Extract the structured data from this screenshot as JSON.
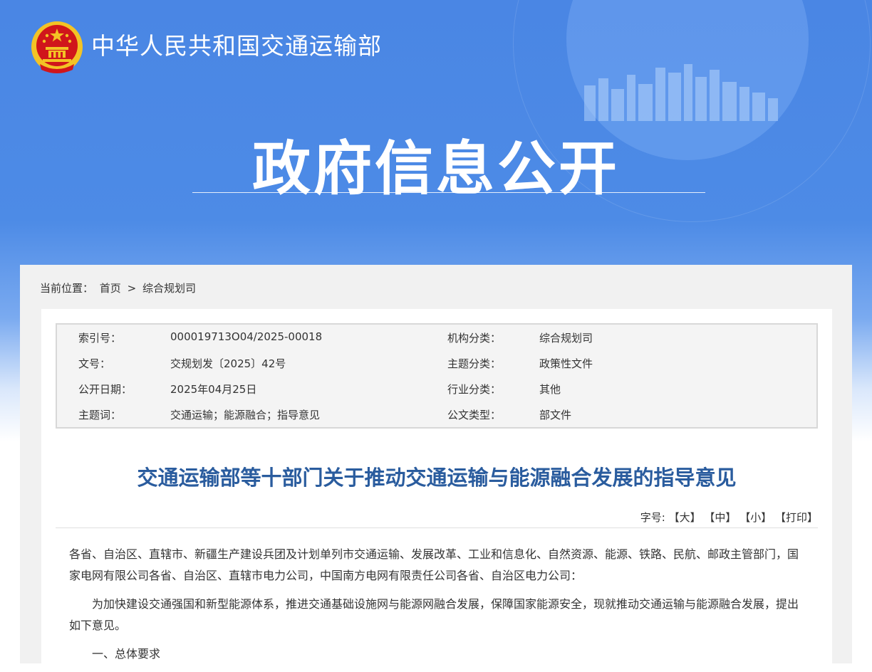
{
  "site": {
    "name": "中华人民共和国交通运输部",
    "banner_title": "政府信息公开"
  },
  "breadcrumb": {
    "prefix": "当前位置：",
    "items": [
      "首页",
      "综合规划司"
    ],
    "separator": ">"
  },
  "meta": {
    "rows": [
      {
        "label1": "索引号：",
        "value1": "000019713O04/2025-00018",
        "label2": "机构分类：",
        "value2": "综合规划司"
      },
      {
        "label1": "文号：",
        "value1": "交规划发〔2025〕42号",
        "label2": "主题分类：",
        "value2": "政策性文件"
      },
      {
        "label1": "公开日期：",
        "value1": "2025年04月25日",
        "label2": "行业分类：",
        "value2": "其他"
      },
      {
        "label1": "主题词：",
        "value1": "交通运输；能源融合；指导意见",
        "label2": "公文类型：",
        "value2": "部文件"
      }
    ]
  },
  "document": {
    "title": "交通运输部等十部门关于推动交通运输与能源融合发展的指导意见",
    "font_size_label": "字号:",
    "font_large": "【大】",
    "font_medium": "【中】",
    "font_small": "【小】",
    "print": "【打印】",
    "paragraphs": [
      "各省、自治区、直辖市、新疆生产建设兵团及计划单列市交通运输、发展改革、工业和信息化、自然资源、能源、铁路、民航、邮政主管部门，国家电网有限公司各省、自治区、直辖市电力公司，中国南方电网有限责任公司各省、自治区电力公司：",
      "为加快建设交通强国和新型能源体系，推进交通基础设施网与能源网融合发展，保障国家能源安全，现就推动交通运输与能源融合发展，提出如下意见。",
      "一、总体要求"
    ]
  },
  "colors": {
    "banner_blue": "#4a86e4",
    "title_blue": "#2a5c9e",
    "emblem_red": "#d0161b",
    "emblem_gold": "#f3c325"
  }
}
